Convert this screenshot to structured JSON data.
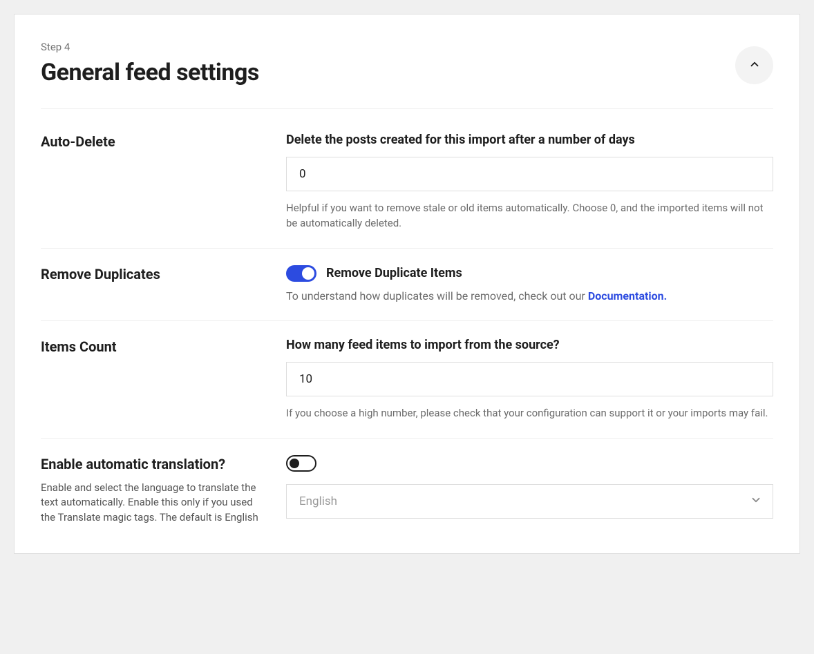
{
  "header": {
    "step_label": "Step 4",
    "title": "General feed settings"
  },
  "sections": {
    "auto_delete": {
      "label": "Auto-Delete",
      "heading": "Delete the posts created for this import after a number of days",
      "value": "0",
      "help": "Helpful if you want to remove stale or old items automatically. Choose 0, and the imported items will not be automatically deleted."
    },
    "remove_duplicates": {
      "label": "Remove Duplicates",
      "toggle_label": "Remove Duplicate Items",
      "toggle_on": true,
      "help_prefix": "To understand how duplicates will be removed, check out our ",
      "help_link": "Documentation."
    },
    "items_count": {
      "label": "Items Count",
      "heading": "How many feed items to import from the source?",
      "value": "10",
      "help": "If you choose a high number, please check that your configuration can support it or your imports may fail."
    },
    "translation": {
      "label": "Enable automatic translation?",
      "sublabel": "Enable and select the language to translate the text automatically. Enable this only if you used the Translate magic tags. The default is English",
      "toggle_on": false,
      "selected_language": "English"
    }
  }
}
